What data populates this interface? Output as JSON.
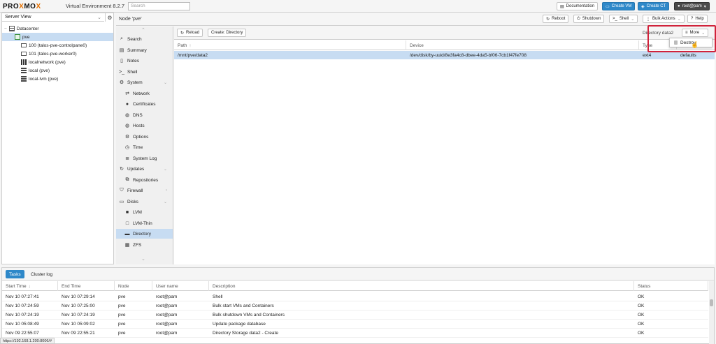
{
  "topbar": {
    "logo_pro": "PRO",
    "logo_x1": "X",
    "logo_mo": "MO",
    "logo_x2": "X",
    "version": "Virtual Environment 8.2.7",
    "search_placeholder": "Search",
    "documentation_label": "Documentation",
    "create_vm_label": "Create VM",
    "create_ct_label": "Create CT",
    "user_label": "root@pam"
  },
  "tree": {
    "view_label": "Server View",
    "items": [
      {
        "label": "Datacenter"
      },
      {
        "label": "pve"
      },
      {
        "label": "100 (talos-pve-controlpane0)"
      },
      {
        "label": "101 (talos-pve-worker0)"
      },
      {
        "label": "localnetwork (pve)"
      },
      {
        "label": "local (pve)"
      },
      {
        "label": "local-lvm (pve)"
      }
    ]
  },
  "node_header": {
    "title": "Node 'pve'",
    "reboot_label": "Reboot",
    "shutdown_label": "Shutdown",
    "shell_label": "Shell",
    "bulk_actions_label": "Bulk Actions",
    "help_label": "Help"
  },
  "menu": {
    "items": [
      {
        "label": "Search"
      },
      {
        "label": "Summary"
      },
      {
        "label": "Notes"
      },
      {
        "label": "Shell"
      },
      {
        "label": "System"
      },
      {
        "label": "Network"
      },
      {
        "label": "Certificates"
      },
      {
        "label": "DNS"
      },
      {
        "label": "Hosts"
      },
      {
        "label": "Options"
      },
      {
        "label": "Time"
      },
      {
        "label": "System Log"
      },
      {
        "label": "Updates"
      },
      {
        "label": "Repositories"
      },
      {
        "label": "Firewall"
      },
      {
        "label": "Disks"
      },
      {
        "label": "LVM"
      },
      {
        "label": "LVM-Thin"
      },
      {
        "label": "Directory"
      },
      {
        "label": "ZFS"
      }
    ]
  },
  "content": {
    "reload_label": "Reload",
    "create_directory_label": "Create: Directory",
    "directory_selected": "Directory data2",
    "more_label": "More",
    "dropdown_destroy_label": "Destroy",
    "columns": {
      "path": "Path",
      "path_sort": "↑",
      "device": "Device",
      "type": "Type"
    },
    "row": {
      "path": "/mnt/pve/data2",
      "device": "/dev/disk/by-uuid/8e3fa4c8-dbee-4da5-bf06-7cb1f47fe708",
      "type": "ext4",
      "options": "defaults"
    }
  },
  "tasks": {
    "tab_tasks": "Tasks",
    "tab_cluster_log": "Cluster log",
    "columns": {
      "start": "Start Time",
      "start_sort": "↓",
      "end": "End Time",
      "node": "Node",
      "user": "User name",
      "description": "Description",
      "status": "Status"
    },
    "rows": [
      {
        "start": "Nov 10 07:27:41",
        "end": "Nov 10 07:29:14",
        "node": "pve",
        "user": "root@pam",
        "description": "Shell",
        "status": "OK"
      },
      {
        "start": "Nov 10 07:24:59",
        "end": "Nov 10 07:25:00",
        "node": "pve",
        "user": "root@pam",
        "description": "Bulk start VMs and Containers",
        "status": "OK"
      },
      {
        "start": "Nov 10 07:24:19",
        "end": "Nov 10 07:24:19",
        "node": "pve",
        "user": "root@pam",
        "description": "Bulk shutdown VMs and Containers",
        "status": "OK"
      },
      {
        "start": "Nov 10 05:08:49",
        "end": "Nov 10 05:09:02",
        "node": "pve",
        "user": "root@pam",
        "description": "Update package database",
        "status": "OK"
      },
      {
        "start": "Nov 09 22:55:07",
        "end": "Nov 09 22:55:21",
        "node": "pve",
        "user": "root@pam",
        "description": "Directory Storage data2 - Create",
        "status": "OK"
      }
    ]
  },
  "status_url": "https://192.168.1.200:8006/#",
  "colors": {
    "accent": "#2e88c9",
    "selection": "#c7dcf2",
    "highlight": "#d0223a",
    "logo_x": "#e57000"
  }
}
